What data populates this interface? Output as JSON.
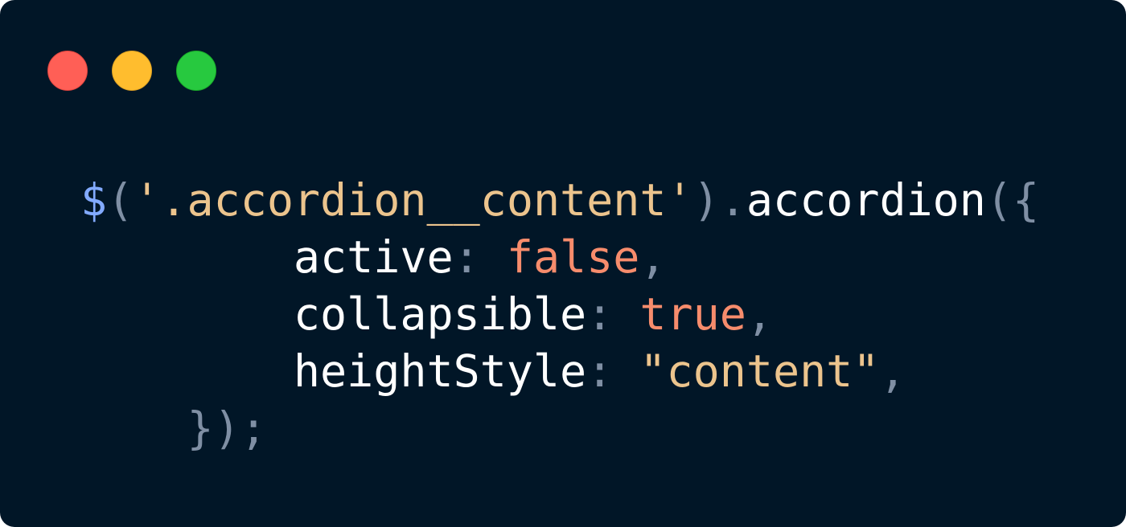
{
  "window": {
    "controls": {
      "close_color": "#ff5f56",
      "minimize_color": "#ffbd2e",
      "maximize_color": "#27c93f"
    },
    "background": "#011627"
  },
  "code": {
    "line1": {
      "dollar": "$",
      "open_paren": "(",
      "selector": "'.accordion__content'",
      "close_paren": ")",
      "dot": ".",
      "method": "accordion",
      "open": "({"
    },
    "line2": {
      "indent": "        ",
      "key": "active",
      "colon": ": ",
      "value": "false",
      "comma": ","
    },
    "line3": {
      "indent": "        ",
      "key": "collapsible",
      "colon": ": ",
      "value": "true",
      "comma": ","
    },
    "line4": {
      "indent": "        ",
      "key": "heightStyle",
      "colon": ": ",
      "value": "\"content\"",
      "comma": ","
    },
    "line5": {
      "indent": "    ",
      "close": "});"
    }
  },
  "colors": {
    "dollar": "#82aaff",
    "punctuation": "#7f8fa4",
    "string": "#ecc48d",
    "identifier": "#ffffff",
    "boolean": "#f78c6c"
  }
}
